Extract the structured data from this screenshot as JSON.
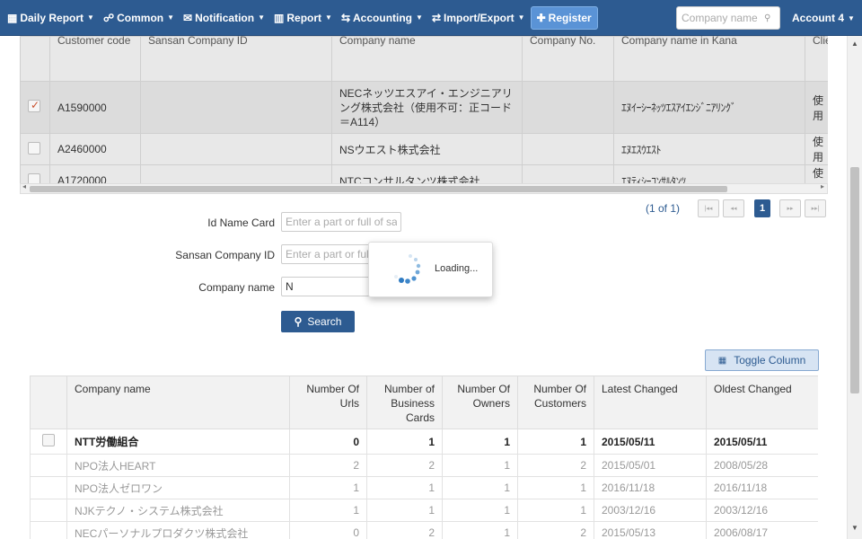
{
  "navbar": {
    "items": [
      {
        "label": "Daily Report"
      },
      {
        "label": "Common"
      },
      {
        "label": "Notification"
      },
      {
        "label": "Report"
      },
      {
        "label": "Accounting"
      },
      {
        "label": "Import/Export"
      }
    ],
    "register_label": "Register",
    "search_placeholder": "Company name",
    "account_label": "Account 4"
  },
  "upper_table": {
    "headers": [
      "Customer code",
      "Sansan Company ID",
      "Company name",
      "Company No.",
      "Company name in Kana",
      "Clie"
    ],
    "rows": [
      {
        "checked": true,
        "code": "A1590000",
        "sansan_id": "",
        "name": "NECネッツエスアイ・エンジニアリング株式会社（使用不可：正コード＝A114）",
        "no": "",
        "kana": "ｴﾇｲｰｼｰﾈｯﾂｴｽｱｲｴﾝｼﾞﾆｱﾘﾝｸﾞ",
        "client": "使用"
      },
      {
        "checked": false,
        "code": "A2460000",
        "sansan_id": "",
        "name": "NSウエスト株式会社",
        "no": "",
        "kana": "ｴﾇｴｽｳｴｽﾄ",
        "client": "使用"
      },
      {
        "checked": false,
        "code": "A1720000",
        "sansan_id": "",
        "name": "NTCコンサルタンツ株式会社",
        "no": "",
        "kana": "ｴﾇﾃｨｼｰｺﾝｻﾙﾀﾝﾂ",
        "client": "使用"
      }
    ]
  },
  "paginator": {
    "info": "(1 of 1)",
    "first": "|◂◂",
    "prev": "◂◂",
    "page": "1",
    "next": "▸▸",
    "last": "▸▸|"
  },
  "search_form": {
    "id_name_card_label": "Id Name Card",
    "id_name_card_placeholder": "Enter a part or full of sar",
    "sansan_label": "Sansan Company ID",
    "sansan_placeholder": "Enter a part or full of sa",
    "company_label": "Company name",
    "company_value": "N",
    "search_label": "Search"
  },
  "loading": {
    "text": "Loading..."
  },
  "toggle_column_label": "Toggle Column",
  "lower_table": {
    "headers": [
      "Company name",
      "Number Of Urls",
      "Number of Business Cards",
      "Number Of Owners",
      "Number Of Customers",
      "Latest Changed",
      "Oldest Changed"
    ],
    "rows": [
      {
        "name": "NTT労働組合",
        "urls": "0",
        "cards": "1",
        "owners": "1",
        "customers": "1",
        "latest": "2015/05/11",
        "oldest": "2015/05/11"
      },
      {
        "name": "NPO法人HEART",
        "urls": "2",
        "cards": "2",
        "owners": "1",
        "customers": "2",
        "latest": "2015/05/01",
        "oldest": "2008/05/28"
      },
      {
        "name": "NPO法人ゼロワン",
        "urls": "1",
        "cards": "1",
        "owners": "1",
        "customers": "1",
        "latest": "2016/11/18",
        "oldest": "2016/11/18"
      },
      {
        "name": "NJKテクノ・システム株式会社",
        "urls": "1",
        "cards": "1",
        "owners": "1",
        "customers": "1",
        "latest": "2003/12/16",
        "oldest": "2003/12/16"
      },
      {
        "name": "NECパーソナルプロダクツ株式会社",
        "urls": "0",
        "cards": "2",
        "owners": "1",
        "customers": "2",
        "latest": "2015/05/13",
        "oldest": "2006/08/17"
      }
    ]
  }
}
